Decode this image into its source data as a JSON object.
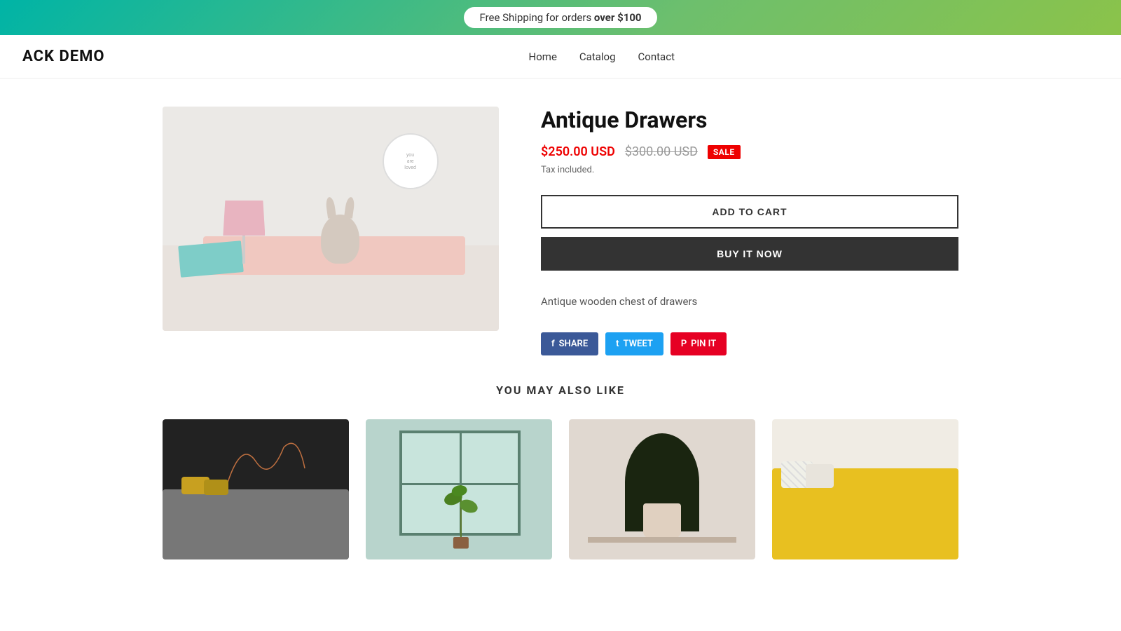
{
  "banner": {
    "text_prefix": "Free Shipping for orders ",
    "text_bold": "over $100"
  },
  "nav": {
    "brand": "ACK DEMO",
    "links": [
      {
        "label": "Home",
        "href": "#"
      },
      {
        "label": "Catalog",
        "href": "#"
      },
      {
        "label": "Contact",
        "href": "#"
      }
    ]
  },
  "product": {
    "title": "Antique Drawers",
    "sale_price": "$250.00 USD",
    "original_price": "$300.00 USD",
    "sale_badge": "SALE",
    "tax_info": "Tax included.",
    "add_to_cart": "ADD TO CART",
    "buy_now": "BUY IT NOW",
    "description": "Antique wooden chest of drawers"
  },
  "social": {
    "share_facebook": "SHARE",
    "share_facebook_prefix": "f",
    "tweet": "TWEET",
    "tweet_prefix": "t",
    "pin_it": "PIN IT",
    "pin_prefix": "P"
  },
  "also_like": {
    "title": "YOU MAY ALSO LIKE",
    "items": [
      {
        "id": "card-1",
        "scene": "dark-room"
      },
      {
        "id": "card-2",
        "scene": "plant-window"
      },
      {
        "id": "card-3",
        "scene": "plants-table"
      },
      {
        "id": "card-4",
        "scene": "yellow-couch"
      }
    ]
  }
}
